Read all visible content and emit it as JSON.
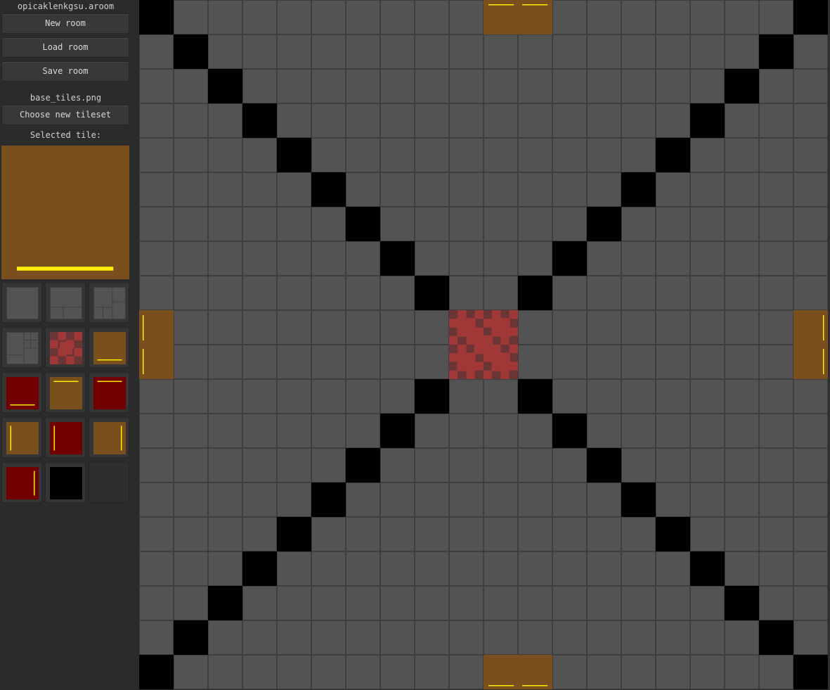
{
  "sidebar": {
    "file_name": "opicaklenkgsu.aroom",
    "new_room_label": "New room",
    "load_room_label": "Load room",
    "save_room_label": "Save room",
    "tileset_name": "base_tiles.png",
    "choose_tileset_label": "Choose new tileset",
    "selected_tile_label": "Selected tile:",
    "selected_tile": "wood-bottom"
  },
  "palette": {
    "tiles": [
      "stone-plain",
      "stone-bricks-bottom",
      "stone-bricks-right",
      "stone-bricks-mixed",
      "red-checker",
      "wood-bottom",
      "red-bottom",
      "wood-top",
      "red-top",
      "wood-left",
      "red-left",
      "wood-right",
      "red-right",
      "void",
      "empty"
    ]
  },
  "room": {
    "cols": 20,
    "rows": 20,
    "rows_data": [
      "V.........WW.......V",
      ".V................V.",
      "..V..............V..",
      "...V............V...",
      "....V..........V....",
      ".....V........V.....",
      "......V......V......",
      ".......V....V.......",
      "........V..V........",
      "M........CC........N",
      "M........CC........N",
      "........V..V........",
      ".......V....V.......",
      "......V......V......",
      ".....V........V.....",
      "....V..........V....",
      "...V............V...",
      "..V..............V..",
      ".V................V.",
      "V.........BB.......V"
    ]
  },
  "colors": {
    "sidebar_bg": "#2b2b2b",
    "floor": "#535353",
    "void": "#000000",
    "wood": "#7a4f1e",
    "red": "#730000",
    "checker_dark": "#6b3535",
    "checker_light": "#a03838",
    "accent_yellow": "#ffee00"
  }
}
